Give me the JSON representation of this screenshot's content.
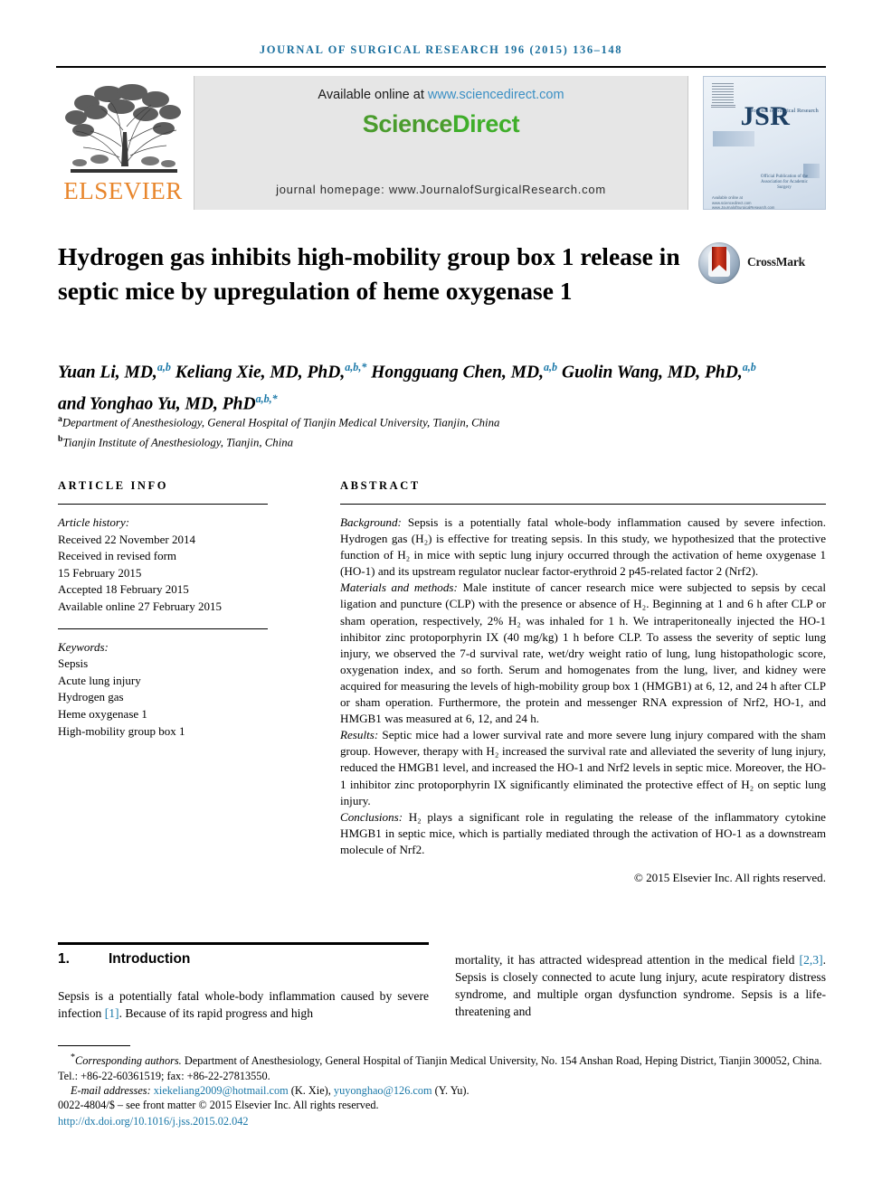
{
  "running_head": "Journal of Surgical Research 196 (2015) 136–148",
  "masthead": {
    "publisher_name": "ELSEVIER",
    "available_prefix": "Available online at ",
    "available_url": "www.sciencedirect.com",
    "sciencedirect_part1": "Science",
    "sciencedirect_part2": "Direct",
    "homepage": "journal homepage: www.JournalofSurgicalResearch.com",
    "cover": {
      "acronym": "JSR",
      "subtitle": "Journal of Surgical Research",
      "society_line": "Official Publication of the Association for Academic Surgery",
      "footer_line": "Available online at www.sciencedirect.com www.JournalofSurgicalResearch.com"
    }
  },
  "article": {
    "title": "Hydrogen gas inhibits high-mobility group box 1 release in septic mice by upregulation of heme oxygenase 1",
    "crossmark_label": "CrossMark",
    "authors_line1_pre": "Yuan Li, MD,",
    "authors": [
      {
        "name": "Yuan Li, MD,",
        "sup": "a,b"
      },
      {
        "name": "Keliang Xie, MD, PhD,",
        "sup": "a,b,*"
      },
      {
        "name": "Hongguang Chen, MD,",
        "sup": "a,b"
      },
      {
        "name": "Guolin Wang, MD, PhD,",
        "sup": "a,b"
      },
      {
        "name": "and Yonghao Yu, MD, PhD",
        "sup": "a,b,*"
      }
    ],
    "affiliations": [
      {
        "marker": "a",
        "text": "Department of Anesthesiology, General Hospital of Tianjin Medical University, Tianjin, China"
      },
      {
        "marker": "b",
        "text": "Tianjin Institute of Anesthesiology, Tianjin, China"
      }
    ]
  },
  "article_info": {
    "heading": "ARTICLE INFO",
    "history_label": "Article history:",
    "history": [
      "Received 22 November 2014",
      "Received in revised form",
      "15 February 2015",
      "Accepted 18 February 2015",
      "Available online 27 February 2015"
    ],
    "keywords_label": "Keywords:",
    "keywords": [
      "Sepsis",
      "Acute lung injury",
      "Hydrogen gas",
      "Heme oxygenase 1",
      "High-mobility group box 1"
    ]
  },
  "abstract": {
    "heading": "ABSTRACT",
    "sections": [
      {
        "label": "Background:",
        "text": " Sepsis is a potentially fatal whole-body inflammation caused by severe infection. Hydrogen gas (H₂) is effective for treating sepsis. In this study, we hypothesized that the protective function of H₂ in mice with septic lung injury occurred through the activation of heme oxygenase 1 (HO-1) and its upstream regulator nuclear factor-erythroid 2 p45-related factor 2 (Nrf2)."
      },
      {
        "label": "Materials and methods:",
        "text": " Male institute of cancer research mice were subjected to sepsis by cecal ligation and puncture (CLP) with the presence or absence of H₂. Beginning at 1 and 6 h after CLP or sham operation, respectively, 2% H₂ was inhaled for 1 h. We intraperitoneally injected the HO-1 inhibitor zinc protoporphyrin IX (40 mg/kg) 1 h before CLP. To assess the severity of septic lung injury, we observed the 7-d survival rate, wet/dry weight ratio of lung, lung histopathologic score, oxygenation index, and so forth. Serum and homogenates from the lung, liver, and kidney were acquired for measuring the levels of high-mobility group box 1 (HMGB1) at 6, 12, and 24 h after CLP or sham operation. Furthermore, the protein and messenger RNA expression of Nrf2, HO-1, and HMGB1 was measured at 6, 12, and 24 h."
      },
      {
        "label": "Results:",
        "text": " Septic mice had a lower survival rate and more severe lung injury compared with the sham group. However, therapy with H₂ increased the survival rate and alleviated the severity of lung injury, reduced the HMGB1 level, and increased the HO-1 and Nrf2 levels in septic mice. Moreover, the HO-1 inhibitor zinc protoporphyrin IX significantly eliminated the protective effect of H₂ on septic lung injury."
      },
      {
        "label": "Conclusions:",
        "text": " H₂ plays a significant role in regulating the release of the inflammatory cytokine HMGB1 in septic mice, which is partially mediated through the activation of HO-1 as a downstream molecule of Nrf2."
      }
    ],
    "copyright": "© 2015 Elsevier Inc. All rights reserved."
  },
  "introduction": {
    "number": "1.",
    "heading": "Introduction",
    "left_column": {
      "part1": "Sepsis is a potentially fatal whole-body inflammation caused by severe infection ",
      "ref1": "[1]",
      "part2": ". Because of its rapid progress and high"
    },
    "right_column": {
      "part1": "mortality, it has attracted widespread attention in the medical field ",
      "ref1": "[2,3]",
      "part2": ". Sepsis is closely connected to acute lung injury, acute respiratory distress syndrome, and multiple organ dysfunction syndrome. Sepsis is a life-threatening and"
    }
  },
  "footnotes": {
    "corresponding_marker": "*",
    "corresponding_label": "Corresponding authors.",
    "corresponding_text": " Department of Anesthesiology, General Hospital of Tianjin Medical University, No. 154 Anshan Road, Heping District, Tianjin 300052, China. Tel.: +86-22-60361519; fax: +86-22-27813550.",
    "email_label": "E-mail addresses:",
    "email1": "xiekeliang2009@hotmail.com",
    "email1_owner": " (K. Xie), ",
    "email2": "yuyonghao@126.com",
    "email2_owner": " (Y. Yu).",
    "issn_line": "0022-4804/$ – see front matter © 2015 Elsevier Inc. All rights reserved.",
    "doi": "http://dx.doi.org/10.1016/j.jss.2015.02.042"
  },
  "colors": {
    "journal_head": "#1a6f9e",
    "link": "#1a78a8",
    "sciencedirect_url": "#3a8fc4",
    "sciencedirect_green": "#4a9c2d",
    "elsevier_orange": "#e8862c",
    "crossmark_red": "#d94326"
  }
}
